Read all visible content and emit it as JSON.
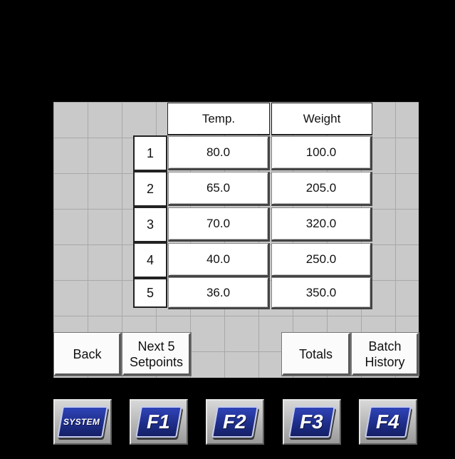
{
  "table": {
    "headers": {
      "temp": "Temp.",
      "weight": "Weight"
    },
    "rows": [
      {
        "index": "1",
        "temp": "80.0",
        "weight": "100.0"
      },
      {
        "index": "2",
        "temp": "65.0",
        "weight": "205.0"
      },
      {
        "index": "3",
        "temp": "70.0",
        "weight": "320.0"
      },
      {
        "index": "4",
        "temp": "40.0",
        "weight": "250.0"
      },
      {
        "index": "5",
        "temp": "36.0",
        "weight": "350.0"
      }
    ]
  },
  "buttons": {
    "back": "Back",
    "next_line1": "Next 5",
    "next_line2": "Setpoints",
    "totals": "Totals",
    "batch_line1": "Batch",
    "batch_line2": "History"
  },
  "function_keys": {
    "system": "SYSTEM",
    "f1": "F1",
    "f2": "F2",
    "f3": "F3",
    "f4": "F4"
  },
  "colors": {
    "background": "#000000",
    "panel_grid": "#c9c9c9",
    "fkey_blue": "#1d2c86"
  }
}
